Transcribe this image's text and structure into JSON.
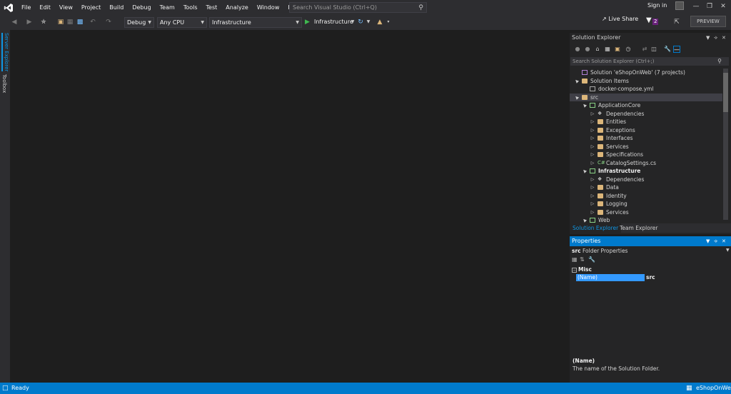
{
  "menu": [
    "File",
    "Edit",
    "View",
    "Project",
    "Build",
    "Debug",
    "Team",
    "Tools",
    "Test",
    "Analyze",
    "Window",
    "Help"
  ],
  "search": {
    "placeholder": "Search Visual Studio (Ctrl+Q)"
  },
  "account": {
    "sign_in": "Sign in"
  },
  "toolbar": {
    "config": "Debug",
    "platform": "Any CPU",
    "startup_project": "Infrastructure",
    "run_target": "Infrastructure",
    "live_share": "Live Share",
    "feedback_count": "2",
    "preview": "PREVIEW"
  },
  "left_tabs": {
    "server_explorer": "Server Explorer",
    "toolbox": "Toolbox"
  },
  "solution_explorer": {
    "title": "Solution Explorer",
    "search_placeholder": "Search Solution Explorer (Ctrl+;)",
    "tree": [
      {
        "label": "Solution 'eShopOnWeb' (7 projects)",
        "depth": 0,
        "twisty": "",
        "icon": "solution"
      },
      {
        "label": "Solution Items",
        "depth": 0,
        "twisty": "▲",
        "icon": "folder"
      },
      {
        "label": "docker-compose.yml",
        "depth": 1,
        "twisty": "",
        "icon": "file"
      },
      {
        "label": "src",
        "depth": 0,
        "twisty": "▲",
        "icon": "folder",
        "selected": true
      },
      {
        "label": "ApplicationCore",
        "depth": 1,
        "twisty": "▲",
        "icon": "project"
      },
      {
        "label": "Dependencies",
        "depth": 2,
        "twisty": "▷",
        "icon": "dependencies"
      },
      {
        "label": "Entities",
        "depth": 2,
        "twisty": "▷",
        "icon": "folder"
      },
      {
        "label": "Exceptions",
        "depth": 2,
        "twisty": "▷",
        "icon": "folder"
      },
      {
        "label": "Interfaces",
        "depth": 2,
        "twisty": "▷",
        "icon": "folder"
      },
      {
        "label": "Services",
        "depth": 2,
        "twisty": "▷",
        "icon": "folder"
      },
      {
        "label": "Specifications",
        "depth": 2,
        "twisty": "▷",
        "icon": "folder"
      },
      {
        "label": "CatalogSettings.cs",
        "depth": 2,
        "twisty": "▷",
        "icon": "csharp"
      },
      {
        "label": "Infrastructure",
        "depth": 1,
        "twisty": "▲",
        "icon": "project",
        "bold": true
      },
      {
        "label": "Dependencies",
        "depth": 2,
        "twisty": "▷",
        "icon": "dependencies"
      },
      {
        "label": "Data",
        "depth": 2,
        "twisty": "▷",
        "icon": "folder"
      },
      {
        "label": "Identity",
        "depth": 2,
        "twisty": "▷",
        "icon": "folder"
      },
      {
        "label": "Logging",
        "depth": 2,
        "twisty": "▷",
        "icon": "folder"
      },
      {
        "label": "Services",
        "depth": 2,
        "twisty": "▷",
        "icon": "folder"
      },
      {
        "label": "Web",
        "depth": 1,
        "twisty": "▲",
        "icon": "project"
      }
    ],
    "tabs": [
      "Solution Explorer",
      "Team Explorer"
    ]
  },
  "properties": {
    "title": "Properties",
    "object_name": "src",
    "object_type": "Folder Properties",
    "category": "Misc",
    "rows": [
      {
        "name": "(Name)",
        "value": "src"
      }
    ],
    "desc_title": "(Name)",
    "desc_text": "The name of the Solution Folder."
  },
  "status": {
    "text": "Ready",
    "project": "eShopOnWeb"
  },
  "colors": {
    "accent": "#007acc",
    "background": "#1e1e1e",
    "chrome": "#2d2d30",
    "panel": "#252526",
    "badge": "#68217a"
  }
}
